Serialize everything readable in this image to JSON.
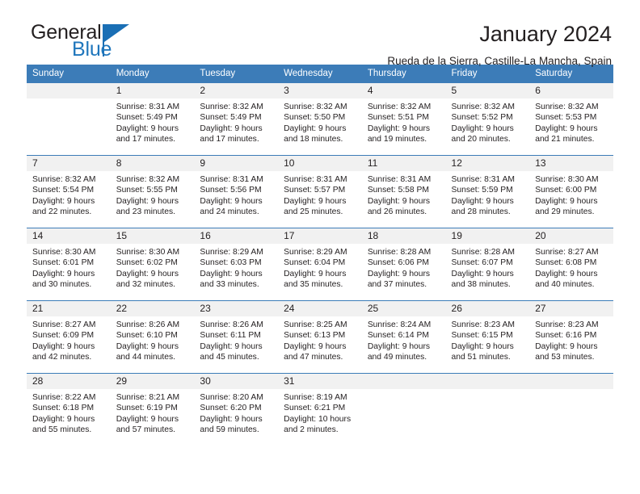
{
  "logo": {
    "word1": "General",
    "word2": "Blue",
    "triangle_color": "#1a6fb5",
    "icon": "triangle-icon"
  },
  "header": {
    "title": "January 2024",
    "location": "Rueda de la Sierra, Castille-La Mancha, Spain"
  },
  "colors": {
    "header_blue": "#3c7cb8",
    "daynum_band": "#f1f1f1",
    "text": "#231f20",
    "logo_blue": "#1f76bc"
  },
  "calendar": {
    "weekday_headers": [
      "Sunday",
      "Monday",
      "Tuesday",
      "Wednesday",
      "Thursday",
      "Friday",
      "Saturday"
    ],
    "weeks": [
      [
        {
          "day": ""
        },
        {
          "day": "1",
          "sunrise": "Sunrise: 8:31 AM",
          "sunset": "Sunset: 5:49 PM",
          "daylight1": "Daylight: 9 hours",
          "daylight2": "and 17 minutes."
        },
        {
          "day": "2",
          "sunrise": "Sunrise: 8:32 AM",
          "sunset": "Sunset: 5:49 PM",
          "daylight1": "Daylight: 9 hours",
          "daylight2": "and 17 minutes."
        },
        {
          "day": "3",
          "sunrise": "Sunrise: 8:32 AM",
          "sunset": "Sunset: 5:50 PM",
          "daylight1": "Daylight: 9 hours",
          "daylight2": "and 18 minutes."
        },
        {
          "day": "4",
          "sunrise": "Sunrise: 8:32 AM",
          "sunset": "Sunset: 5:51 PM",
          "daylight1": "Daylight: 9 hours",
          "daylight2": "and 19 minutes."
        },
        {
          "day": "5",
          "sunrise": "Sunrise: 8:32 AM",
          "sunset": "Sunset: 5:52 PM",
          "daylight1": "Daylight: 9 hours",
          "daylight2": "and 20 minutes."
        },
        {
          "day": "6",
          "sunrise": "Sunrise: 8:32 AM",
          "sunset": "Sunset: 5:53 PM",
          "daylight1": "Daylight: 9 hours",
          "daylight2": "and 21 minutes."
        }
      ],
      [
        {
          "day": "7",
          "sunrise": "Sunrise: 8:32 AM",
          "sunset": "Sunset: 5:54 PM",
          "daylight1": "Daylight: 9 hours",
          "daylight2": "and 22 minutes."
        },
        {
          "day": "8",
          "sunrise": "Sunrise: 8:32 AM",
          "sunset": "Sunset: 5:55 PM",
          "daylight1": "Daylight: 9 hours",
          "daylight2": "and 23 minutes."
        },
        {
          "day": "9",
          "sunrise": "Sunrise: 8:31 AM",
          "sunset": "Sunset: 5:56 PM",
          "daylight1": "Daylight: 9 hours",
          "daylight2": "and 24 minutes."
        },
        {
          "day": "10",
          "sunrise": "Sunrise: 8:31 AM",
          "sunset": "Sunset: 5:57 PM",
          "daylight1": "Daylight: 9 hours",
          "daylight2": "and 25 minutes."
        },
        {
          "day": "11",
          "sunrise": "Sunrise: 8:31 AM",
          "sunset": "Sunset: 5:58 PM",
          "daylight1": "Daylight: 9 hours",
          "daylight2": "and 26 minutes."
        },
        {
          "day": "12",
          "sunrise": "Sunrise: 8:31 AM",
          "sunset": "Sunset: 5:59 PM",
          "daylight1": "Daylight: 9 hours",
          "daylight2": "and 28 minutes."
        },
        {
          "day": "13",
          "sunrise": "Sunrise: 8:30 AM",
          "sunset": "Sunset: 6:00 PM",
          "daylight1": "Daylight: 9 hours",
          "daylight2": "and 29 minutes."
        }
      ],
      [
        {
          "day": "14",
          "sunrise": "Sunrise: 8:30 AM",
          "sunset": "Sunset: 6:01 PM",
          "daylight1": "Daylight: 9 hours",
          "daylight2": "and 30 minutes."
        },
        {
          "day": "15",
          "sunrise": "Sunrise: 8:30 AM",
          "sunset": "Sunset: 6:02 PM",
          "daylight1": "Daylight: 9 hours",
          "daylight2": "and 32 minutes."
        },
        {
          "day": "16",
          "sunrise": "Sunrise: 8:29 AM",
          "sunset": "Sunset: 6:03 PM",
          "daylight1": "Daylight: 9 hours",
          "daylight2": "and 33 minutes."
        },
        {
          "day": "17",
          "sunrise": "Sunrise: 8:29 AM",
          "sunset": "Sunset: 6:04 PM",
          "daylight1": "Daylight: 9 hours",
          "daylight2": "and 35 minutes."
        },
        {
          "day": "18",
          "sunrise": "Sunrise: 8:28 AM",
          "sunset": "Sunset: 6:06 PM",
          "daylight1": "Daylight: 9 hours",
          "daylight2": "and 37 minutes."
        },
        {
          "day": "19",
          "sunrise": "Sunrise: 8:28 AM",
          "sunset": "Sunset: 6:07 PM",
          "daylight1": "Daylight: 9 hours",
          "daylight2": "and 38 minutes."
        },
        {
          "day": "20",
          "sunrise": "Sunrise: 8:27 AM",
          "sunset": "Sunset: 6:08 PM",
          "daylight1": "Daylight: 9 hours",
          "daylight2": "and 40 minutes."
        }
      ],
      [
        {
          "day": "21",
          "sunrise": "Sunrise: 8:27 AM",
          "sunset": "Sunset: 6:09 PM",
          "daylight1": "Daylight: 9 hours",
          "daylight2": "and 42 minutes."
        },
        {
          "day": "22",
          "sunrise": "Sunrise: 8:26 AM",
          "sunset": "Sunset: 6:10 PM",
          "daylight1": "Daylight: 9 hours",
          "daylight2": "and 44 minutes."
        },
        {
          "day": "23",
          "sunrise": "Sunrise: 8:26 AM",
          "sunset": "Sunset: 6:11 PM",
          "daylight1": "Daylight: 9 hours",
          "daylight2": "and 45 minutes."
        },
        {
          "day": "24",
          "sunrise": "Sunrise: 8:25 AM",
          "sunset": "Sunset: 6:13 PM",
          "daylight1": "Daylight: 9 hours",
          "daylight2": "and 47 minutes."
        },
        {
          "day": "25",
          "sunrise": "Sunrise: 8:24 AM",
          "sunset": "Sunset: 6:14 PM",
          "daylight1": "Daylight: 9 hours",
          "daylight2": "and 49 minutes."
        },
        {
          "day": "26",
          "sunrise": "Sunrise: 8:23 AM",
          "sunset": "Sunset: 6:15 PM",
          "daylight1": "Daylight: 9 hours",
          "daylight2": "and 51 minutes."
        },
        {
          "day": "27",
          "sunrise": "Sunrise: 8:23 AM",
          "sunset": "Sunset: 6:16 PM",
          "daylight1": "Daylight: 9 hours",
          "daylight2": "and 53 minutes."
        }
      ],
      [
        {
          "day": "28",
          "sunrise": "Sunrise: 8:22 AM",
          "sunset": "Sunset: 6:18 PM",
          "daylight1": "Daylight: 9 hours",
          "daylight2": "and 55 minutes."
        },
        {
          "day": "29",
          "sunrise": "Sunrise: 8:21 AM",
          "sunset": "Sunset: 6:19 PM",
          "daylight1": "Daylight: 9 hours",
          "daylight2": "and 57 minutes."
        },
        {
          "day": "30",
          "sunrise": "Sunrise: 8:20 AM",
          "sunset": "Sunset: 6:20 PM",
          "daylight1": "Daylight: 9 hours",
          "daylight2": "and 59 minutes."
        },
        {
          "day": "31",
          "sunrise": "Sunrise: 8:19 AM",
          "sunset": "Sunset: 6:21 PM",
          "daylight1": "Daylight: 10 hours",
          "daylight2": "and 2 minutes."
        },
        {
          "day": ""
        },
        {
          "day": ""
        },
        {
          "day": ""
        }
      ]
    ]
  }
}
